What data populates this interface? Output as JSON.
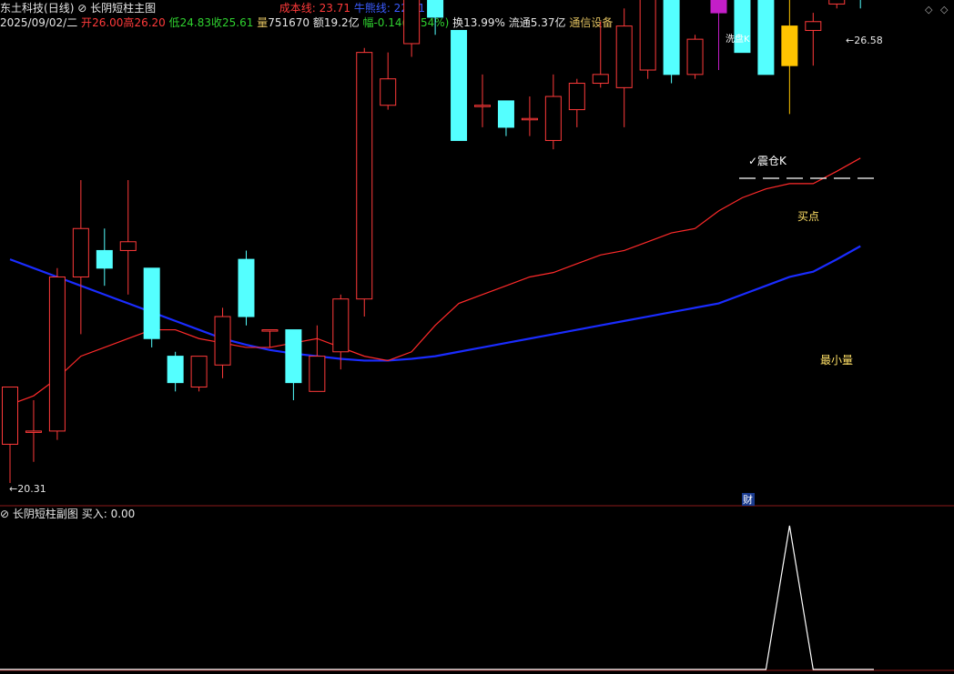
{
  "window": {
    "stock_name": "东土科技",
    "period": "(日线)",
    "indicator": "长阴短柱主图",
    "cost_label": "成本线: 23.71",
    "bull_label": "牛熊线: 22.71"
  },
  "quote": {
    "date": "2025/09/02/二",
    "open_label": "开",
    "open": "26.00",
    "high_label": "高",
    "high": "26.20",
    "low_label": "低",
    "low": "24.83",
    "close_label": "收",
    "close": "25.61",
    "volume_label": "量",
    "volume": "751670",
    "amount_label": "额",
    "amount": "19.2亿",
    "change_label": "幅",
    "change": "-0.14(-0.54%)",
    "turnover_label": "换",
    "turnover": "13.99%",
    "float_label": "流通",
    "float": "5.37亿",
    "sector": "通信设备"
  },
  "sub_panel": {
    "title": "长阴短柱副图",
    "value_label": "买入: 0.00"
  },
  "colors": {
    "up": "#ff3a3a",
    "down": "#54ffff",
    "cost_line": "#ff2a2a",
    "bull_line": "#1a2cff",
    "washout_candle": "#c41ec8",
    "min_volume_candle": "#ffc400"
  },
  "icons": [
    "collapse-icon",
    "diamond-icon",
    "finance-badge-icon"
  ],
  "chart_data": {
    "type": "candlestick",
    "series_points": "OHLC values estimated from the price axis",
    "candles": [
      {
        "o": 20.75,
        "h": 21.25,
        "l": 20.31,
        "c": 21.4,
        "dir": "up"
      },
      {
        "o": 20.9,
        "h": 21.25,
        "l": 20.55,
        "c": 20.9,
        "dir": "flat"
      },
      {
        "o": 20.9,
        "h": 22.75,
        "l": 20.8,
        "c": 22.65,
        "dir": "up"
      },
      {
        "o": 22.65,
        "h": 23.75,
        "l": 22.0,
        "c": 23.2,
        "dir": "up"
      },
      {
        "o": 22.95,
        "h": 23.2,
        "l": 22.55,
        "c": 22.75,
        "dir": "down"
      },
      {
        "o": 22.95,
        "h": 23.75,
        "l": 22.45,
        "c": 23.05,
        "dir": "up"
      },
      {
        "o": 22.75,
        "h": 22.75,
        "l": 21.85,
        "c": 21.95,
        "dir": "down"
      },
      {
        "o": 21.75,
        "h": 21.8,
        "l": 21.35,
        "c": 21.45,
        "dir": "down"
      },
      {
        "o": 21.4,
        "h": 21.75,
        "l": 21.35,
        "c": 21.75,
        "dir": "up"
      },
      {
        "o": 21.65,
        "h": 22.3,
        "l": 21.5,
        "c": 22.2,
        "dir": "up"
      },
      {
        "o": 22.85,
        "h": 22.95,
        "l": 22.1,
        "c": 22.2,
        "dir": "down"
      },
      {
        "o": 22.05,
        "h": 22.05,
        "l": 21.85,
        "c": 22.05,
        "dir": "flat"
      },
      {
        "o": 22.05,
        "h": 22.05,
        "l": 21.25,
        "c": 21.45,
        "dir": "down"
      },
      {
        "o": 21.35,
        "h": 22.1,
        "l": 21.35,
        "c": 21.75,
        "dir": "up"
      },
      {
        "o": 21.8,
        "h": 22.45,
        "l": 21.6,
        "c": 22.4,
        "dir": "up"
      },
      {
        "o": 22.4,
        "h": 25.25,
        "l": 22.2,
        "c": 25.2,
        "dir": "up"
      },
      {
        "o": 24.6,
        "h": 25.2,
        "l": 24.55,
        "c": 24.9,
        "dir": "up"
      },
      {
        "o": 25.3,
        "h": 26.4,
        "l": 25.15,
        "c": 26.15,
        "dir": "up"
      },
      {
        "o": 26.0,
        "h": 26.05,
        "l": 25.4,
        "c": 25.6,
        "dir": "down"
      },
      {
        "o": 25.45,
        "h": 25.45,
        "l": 24.2,
        "c": 24.2,
        "dir": "down"
      },
      {
        "o": 24.6,
        "h": 24.95,
        "l": 24.35,
        "c": 24.6,
        "dir": "flat"
      },
      {
        "o": 24.65,
        "h": 24.65,
        "l": 24.25,
        "c": 24.35,
        "dir": "down"
      },
      {
        "o": 24.45,
        "h": 24.7,
        "l": 24.25,
        "c": 24.45,
        "dir": "flat"
      },
      {
        "o": 24.2,
        "h": 24.95,
        "l": 24.1,
        "c": 24.7,
        "dir": "up"
      },
      {
        "o": 24.55,
        "h": 24.9,
        "l": 24.35,
        "c": 24.85,
        "dir": "up"
      },
      {
        "o": 24.85,
        "h": 25.55,
        "l": 24.8,
        "c": 24.95,
        "dir": "up"
      },
      {
        "o": 24.8,
        "h": 25.7,
        "l": 24.35,
        "c": 25.5,
        "dir": "up"
      },
      {
        "o": 25.0,
        "h": 25.95,
        "l": 24.9,
        "c": 25.85,
        "dir": "up"
      },
      {
        "o": 25.8,
        "h": 25.95,
        "l": 24.85,
        "c": 24.95,
        "dir": "down"
      },
      {
        "o": 24.95,
        "h": 25.4,
        "l": 24.9,
        "c": 25.35,
        "dir": "up"
      },
      {
        "o": 26.45,
        "h": 27.55,
        "l": 25.0,
        "c": 25.65,
        "dir": "down",
        "special": "washout"
      },
      {
        "o": 26.05,
        "h": 26.05,
        "l": 25.2,
        "c": 25.2,
        "dir": "down"
      },
      {
        "o": 26.0,
        "h": 26.0,
        "l": 24.95,
        "c": 24.95,
        "dir": "down"
      },
      {
        "o": 25.5,
        "h": 25.85,
        "l": 24.5,
        "c": 25.05,
        "dir": "down",
        "special": "min-volume"
      },
      {
        "o": 25.45,
        "h": 25.65,
        "l": 25.05,
        "c": 25.55,
        "dir": "up"
      },
      {
        "o": 25.75,
        "h": 26.58,
        "l": 25.7,
        "c": 25.9,
        "dir": "up"
      },
      {
        "o": 25.9,
        "h": 26.5,
        "l": 25.7,
        "c": 25.85,
        "dir": "down"
      }
    ],
    "cost_line": [
      21.2,
      21.3,
      21.5,
      21.75,
      21.85,
      21.95,
      22.05,
      22.05,
      21.95,
      21.9,
      21.85,
      21.85,
      21.9,
      21.95,
      21.85,
      21.75,
      21.7,
      21.8,
      22.1,
      22.35,
      22.45,
      22.55,
      22.65,
      22.7,
      22.8,
      22.9,
      22.95,
      23.05,
      23.15,
      23.2,
      23.4,
      23.55,
      23.65,
      23.71,
      23.71,
      23.85,
      24.0
    ],
    "bull_line": [
      22.85,
      22.75,
      22.65,
      22.55,
      22.45,
      22.35,
      22.25,
      22.15,
      22.05,
      21.95,
      21.88,
      21.82,
      21.78,
      21.75,
      21.72,
      21.7,
      21.7,
      21.72,
      21.75,
      21.8,
      21.85,
      21.9,
      21.95,
      22.0,
      22.05,
      22.1,
      22.15,
      22.2,
      22.25,
      22.3,
      22.35,
      22.45,
      22.55,
      22.65,
      22.71,
      22.85,
      23.0
    ],
    "annotations": {
      "low_label": "20.31",
      "high_label": "26.58",
      "washout_k_top": "洗盘K",
      "washout_k_mid": "✓震仓K",
      "buy_point": "买点",
      "min_volume": "最小量",
      "finance_badge": "财"
    },
    "sub_series": {
      "name": "买入",
      "values": [
        0,
        0,
        0,
        0,
        0,
        0,
        0,
        0,
        0,
        0,
        0,
        0,
        0,
        0,
        0,
        0,
        0,
        0,
        0,
        0,
        0,
        0,
        0,
        0,
        0,
        0,
        0,
        0,
        0,
        0,
        0,
        0,
        0,
        1,
        0,
        0,
        0
      ]
    }
  }
}
